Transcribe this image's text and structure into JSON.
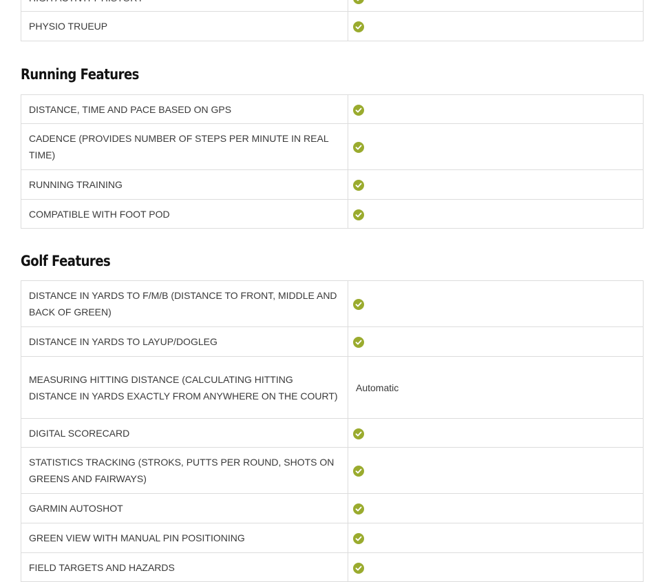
{
  "top_section": {
    "rows": [
      {
        "feature": "HIGH ACTIVITY HISTORY",
        "value_type": "check",
        "check_icon": "check-circle-icon"
      },
      {
        "feature": "PHYSIO TRUEUP",
        "value_type": "check",
        "check_icon": "check-circle-icon"
      }
    ]
  },
  "running_section": {
    "title": "Running Features",
    "rows": [
      {
        "feature": "DISTANCE, TIME AND PACE BASED ON GPS",
        "value_type": "check"
      },
      {
        "feature": "CADENCE (PROVIDES NUMBER OF STEPS PER MINUTE IN REAL TIME)",
        "value_type": "check"
      },
      {
        "feature": "RUNNING TRAINING",
        "value_type": "check"
      },
      {
        "feature": "COMPATIBLE WITH FOOT POD",
        "value_type": "check"
      }
    ]
  },
  "golf_section": {
    "title": "Golf Features",
    "rows": [
      {
        "feature": "DISTANCE IN YARDS TO F/M/B (DISTANCE TO FRONT, MIDDLE AND BACK OF GREEN)",
        "value_type": "check"
      },
      {
        "feature": "DISTANCE IN YARDS TO LAYUP/DOGLEG",
        "value_type": "check"
      },
      {
        "feature": "MEASURING HITTING DISTANCE (CALCULATING HITTING DISTANCE IN YARDS EXACTLY FROM ANYWHERE ON THE COURT)",
        "value_type": "text",
        "value": "Automatic"
      },
      {
        "feature": "DIGITAL SCORECARD",
        "value_type": "check"
      },
      {
        "feature": "STATISTICS TRACKING (STROKS, PUTTS PER ROUND, SHOTS ON GREENS AND FAIRWAYS)",
        "value_type": "check"
      },
      {
        "feature": "GARMIN AUTOSHOT",
        "value_type": "check"
      },
      {
        "feature": "GREEN VIEW WITH MANUAL PIN POSITIONING",
        "value_type": "check"
      },
      {
        "feature": "FIELD TARGETS AND HAZARDS",
        "value_type": "check"
      }
    ]
  },
  "colors": {
    "check_green": "#9aab2e",
    "border": "#dcdcdc",
    "heading": "#111111",
    "text": "#3a3a3a"
  }
}
